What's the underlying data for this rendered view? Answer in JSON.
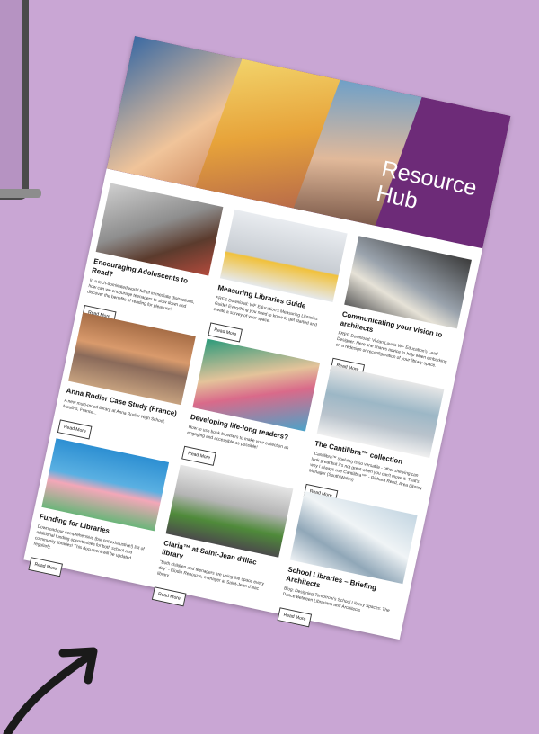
{
  "hub": {
    "title_line1": "Resource",
    "title_line2": "Hub"
  },
  "read_more": "Read More",
  "cards": [
    {
      "title": "Encouraging Adolescents to Read?",
      "text": "In a tech-dominated world full of immediate distractions, how can we encourage teenagers to slow down and discover the benefits of reading for pleasure?"
    },
    {
      "title": "Measuring Libraries Guide",
      "text": "FREE Download: WF Education's Measuring Libraries Guide! Everything you need to know to get started and create a survey of your space."
    },
    {
      "title": "Communicating your vision to architects",
      "text": "FREE Download: Vivian Low is WF Education's Lead Designer. Here she shares advice to help when embarking on a redesign or reconfiguration of your library space."
    },
    {
      "title": "Anna Rodier Case Study (France)",
      "text": "A new multi-mood library at Anna Rodier High School, Moulins, France..."
    },
    {
      "title": "Developing life-long readers?",
      "text": "How to use book browsers to make your collection as engaging and accessible as possible!"
    },
    {
      "title": "The Cantilibra™ collection",
      "text": "\"Cantilibra™ shelving is so versatile - other shelving can look great but it's not great when you can't move it. That's why I always use Cantilibra™\" - Richard Reed, Area Library Manager (South Wales)"
    },
    {
      "title": "Funding for Libraries",
      "text": "Download our comprehensive (but not exhaustive!) list of additional funding opportunities for both school and community libraries! This document will be updated regularly."
    },
    {
      "title": "Claria™ at Saint-Jean d'Illac library",
      "text": "\"Both children and teenagers are using the space every day\" - Elodie Rehouzin, manager at Saint-Jean d'Illac library"
    },
    {
      "title": "School Libraries – Briefing Architects",
      "text": "Blog: Designing Tomorrow's School Library Spaces: The Dance Between Librarians and Architects"
    }
  ]
}
